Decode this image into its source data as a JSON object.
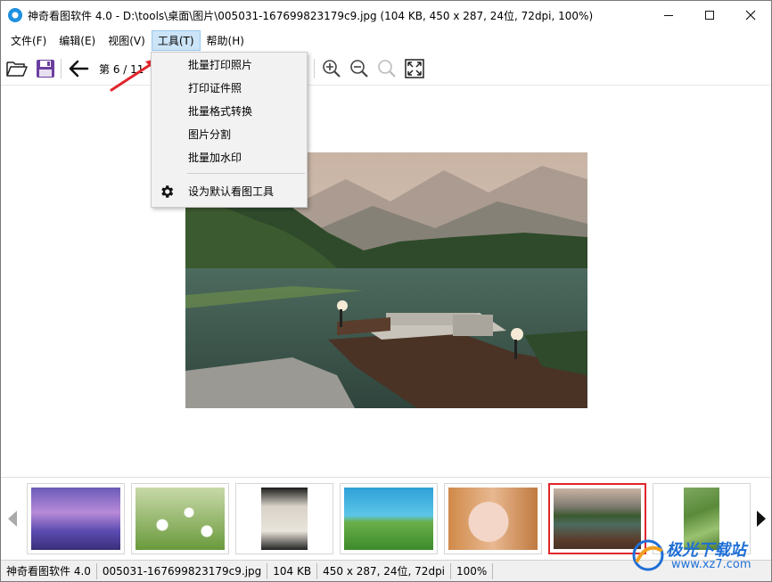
{
  "window": {
    "title": "神奇看图软件 4.0 - D:\\tools\\桌面\\图片\\005031-167699823179c9.jpg (104 KB, 450 x 287, 24位, 72dpi, 100%)"
  },
  "menu": {
    "items": [
      {
        "label": "文件(F)"
      },
      {
        "label": "编辑(E)"
      },
      {
        "label": "视图(V)"
      },
      {
        "label": "工具(T)"
      },
      {
        "label": "帮助(H)"
      }
    ],
    "active_index": 3
  },
  "toolbar": {
    "page_indicator": "第 6 / 11"
  },
  "tools_menu": {
    "items": [
      {
        "label": "批量打印照片"
      },
      {
        "label": "打印证件照"
      },
      {
        "label": "批量格式转换"
      },
      {
        "label": "图片分割"
      },
      {
        "label": "批量加水印"
      }
    ],
    "default_label": "设为默认看图工具"
  },
  "statusbar": {
    "app": "神奇看图软件 4.0",
    "filename": "005031-167699823179c9.jpg",
    "size": "104 KB",
    "info": "450 x 287, 24位, 72dpi",
    "zoom": "100%"
  },
  "watermark": {
    "brand": "极光下载站",
    "url": "www.xz7.com"
  },
  "colors": {
    "accent": "#e0262c",
    "menu_active": "#cce4f7",
    "watermark": "#1f6fd6"
  }
}
